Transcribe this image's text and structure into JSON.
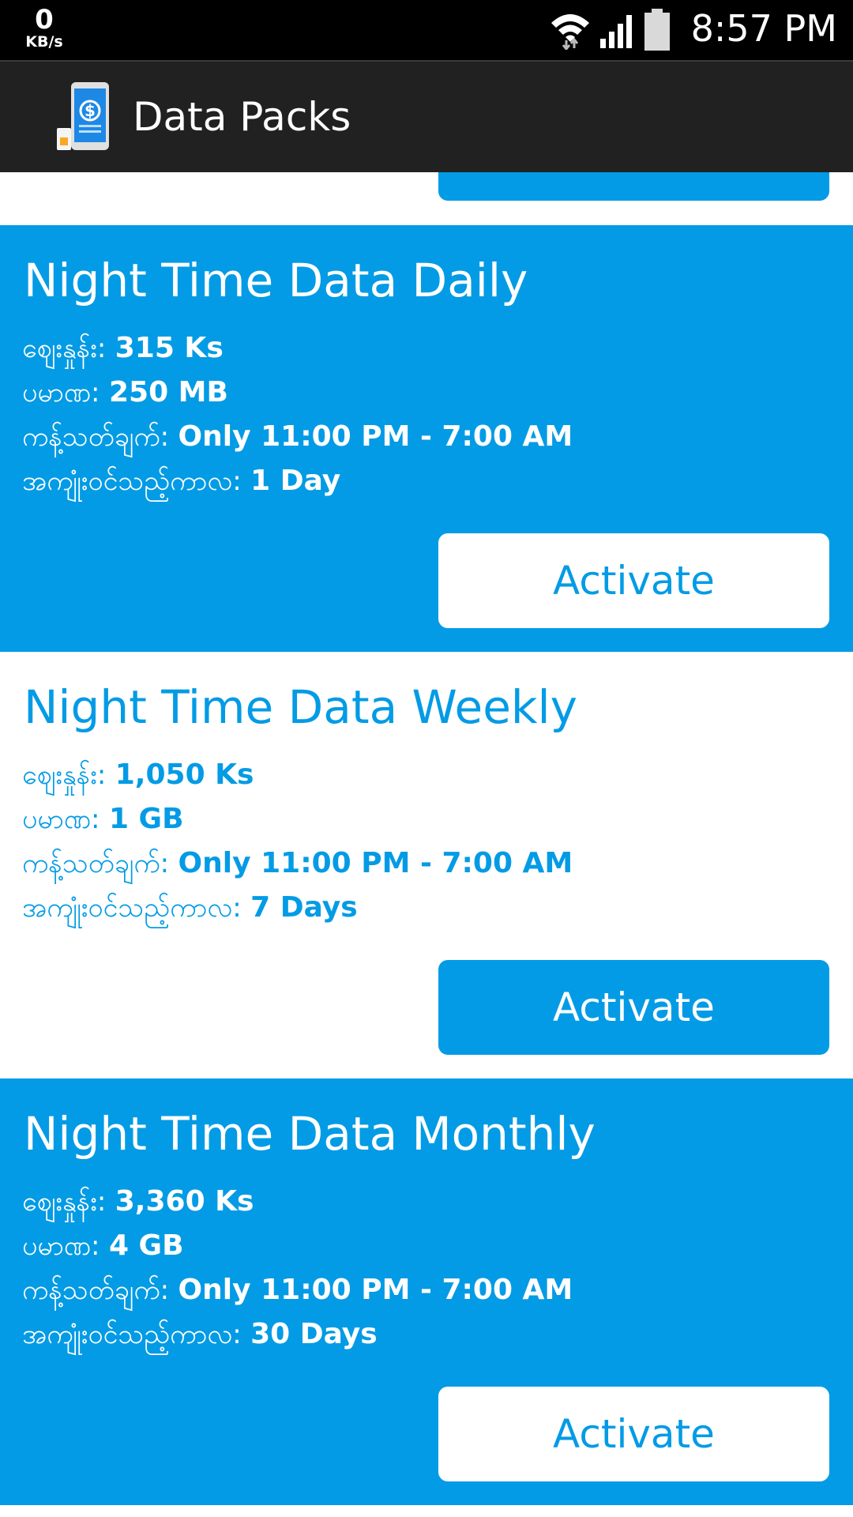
{
  "status_bar": {
    "net_speed_value": "0",
    "net_speed_unit": "KB/s",
    "time": "8:57 PM",
    "icons": [
      "wifi-icon",
      "signal-icon",
      "battery-icon"
    ]
  },
  "app_bar": {
    "title": "Data Packs",
    "icon": "phone-dollar-icon"
  },
  "colors": {
    "accent": "#039be5",
    "app_bar": "#212121",
    "status_bar": "#000000"
  },
  "labels": {
    "price": "ဈေးနှုန်း:",
    "volume": "ပမာဏ:",
    "restriction": "ကန့်သတ်ချက်:",
    "validity": "အကျုံးဝင်သည့်ကာလ:"
  },
  "packs": [
    {
      "title": "Night Time Data Daily",
      "price": "315 Ks",
      "volume": "250 MB",
      "restriction": "Only 11:00 PM - 7:00 AM",
      "validity": "1 Day",
      "button": "Activate"
    },
    {
      "title": "Night Time Data Weekly",
      "price": "1,050 Ks",
      "volume": "1 GB",
      "restriction": "Only 11:00 PM - 7:00 AM",
      "validity": "7 Days",
      "button": "Activate"
    },
    {
      "title": "Night Time Data Monthly",
      "price": "3,360 Ks",
      "volume": "4 GB",
      "restriction": "Only 11:00 PM - 7:00 AM",
      "validity": "30 Days",
      "button": "Activate"
    }
  ]
}
